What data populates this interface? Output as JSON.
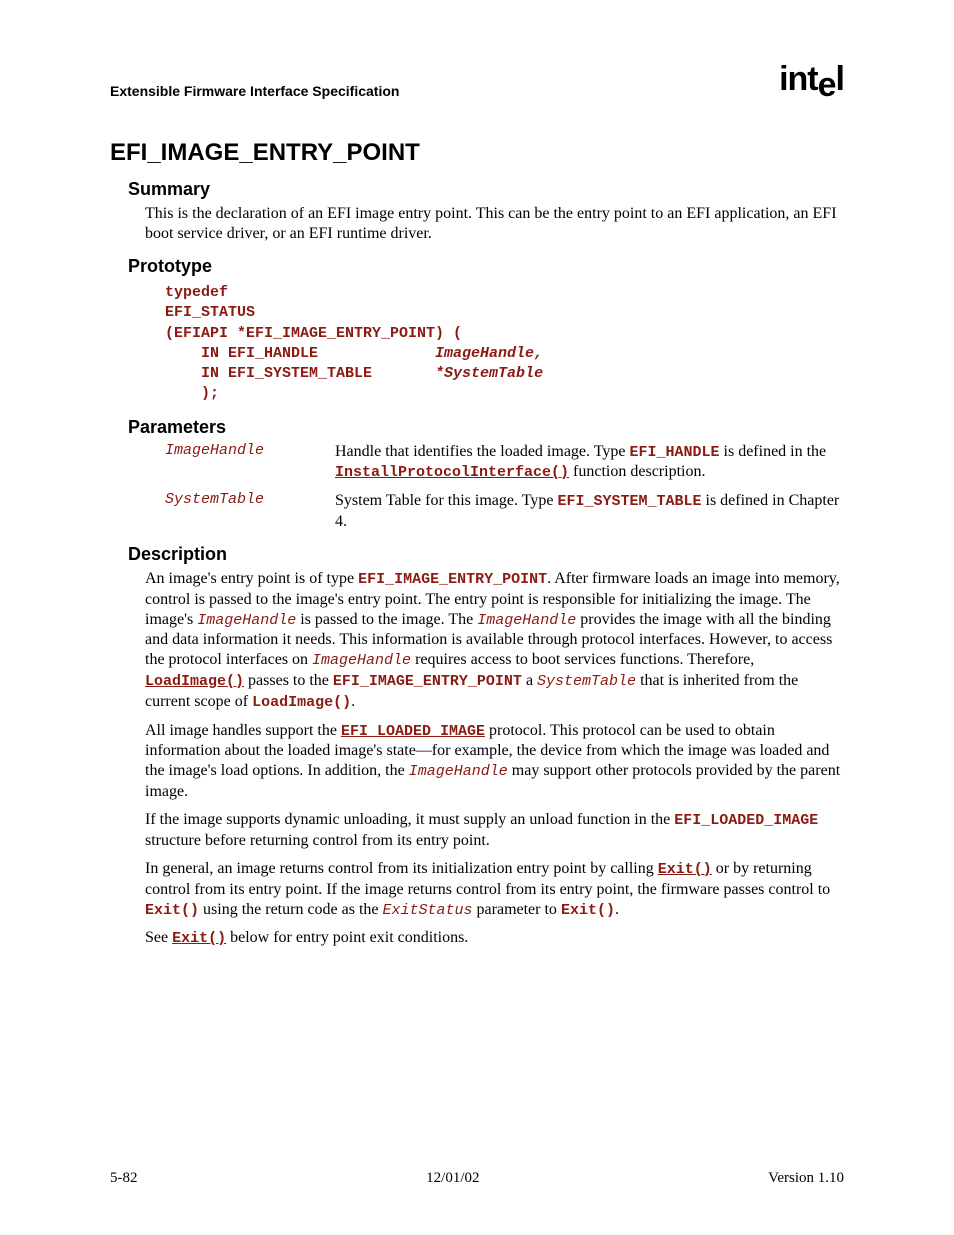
{
  "header": {
    "doc_title": "Extensible Firmware Interface Specification",
    "logo_text_1": "int",
    "logo_text_2": "e",
    "logo_text_3": "l"
  },
  "title": "EFI_IMAGE_ENTRY_POINT",
  "summary": {
    "heading": "Summary",
    "text": "This is the declaration of an EFI image entry point.  This can be the entry point to an EFI application, an EFI boot service driver, or an EFI runtime driver."
  },
  "prototype": {
    "heading": "Prototype",
    "lines": {
      "l1": "typedef",
      "l2": "EFI_STATUS",
      "l3": "(EFIAPI *EFI_IMAGE_ENTRY_POINT) (",
      "l4a": "    IN EFI_HANDLE             ",
      "l4b": "ImageHandle,",
      "l5a": "    IN EFI_SYSTEM_TABLE       ",
      "l5b": "*SystemTable",
      "l6": "    );"
    }
  },
  "parameters": {
    "heading": "Parameters",
    "rows": [
      {
        "name": "ImageHandle",
        "d1": "Handle that identifies the loaded image.  Type ",
        "d2": "EFI_HANDLE",
        "d3": " is defined in the ",
        "d4": "InstallProtocolInterface()",
        "d5": " function description."
      },
      {
        "name": "SystemTable",
        "d1": "System Table for this image.  Type ",
        "d2": "EFI_SYSTEM_TABLE",
        "d3": " is defined in Chapter 4."
      }
    ]
  },
  "description": {
    "heading": "Description",
    "p1": {
      "t1": "An image's entry point is of type ",
      "c1": "EFI_IMAGE_ENTRY_POINT",
      "t2": ".  After firmware loads an image into memory, control is passed to the image's entry point.  The entry point is responsible for initializing the image.  The image's ",
      "c2": "ImageHandle",
      "t3": " is passed to the image.  The ",
      "c3": "ImageHandle",
      "t4": " provides the image with all the binding and data information it needs.  This information is available through protocol interfaces.  However, to access the protocol interfaces on ",
      "c4": "ImageHandle",
      "t5": " requires access to boot services functions.  Therefore, ",
      "c5": "LoadImage()",
      "t6": " passes to the ",
      "c6": "EFI_IMAGE_ENTRY_POINT",
      "t7": " a ",
      "c7": "SystemTable",
      "t8": " that is inherited from the current scope of ",
      "c8": "LoadImage()",
      "t9": "."
    },
    "p2": {
      "t1": "All image handles support the ",
      "c1": "EFI_LOADED_IMAGE",
      "t2": " protocol.  This protocol can be used to obtain information about the loaded image's state—for example, the device from which the image was loaded and the image's load options.  In addition, the ",
      "c2": "ImageHandle",
      "t3": " may support other protocols provided by the parent image."
    },
    "p3": {
      "t1": "If the image supports dynamic unloading, it must supply an unload function in the ",
      "c1": "EFI_LOADED_IMAGE",
      "t2": " structure before returning control from its entry point."
    },
    "p4": {
      "t1": "In general, an image returns control from its initialization entry point by calling ",
      "c1": "Exit()",
      "t2": " or by returning control from its entry point.  If the image returns control from its entry point, the firmware passes control to ",
      "c2": "Exit()",
      "t3": " using the return code as the ",
      "c3": "ExitStatus",
      "t4": " parameter to ",
      "c4": "Exit()",
      "t5": "."
    },
    "p5": {
      "t1": "See ",
      "c1": "Exit()",
      "t2": " below for entry point exit conditions."
    }
  },
  "footer": {
    "left": "5-82",
    "center": "12/01/02",
    "right": "Version 1.10"
  }
}
